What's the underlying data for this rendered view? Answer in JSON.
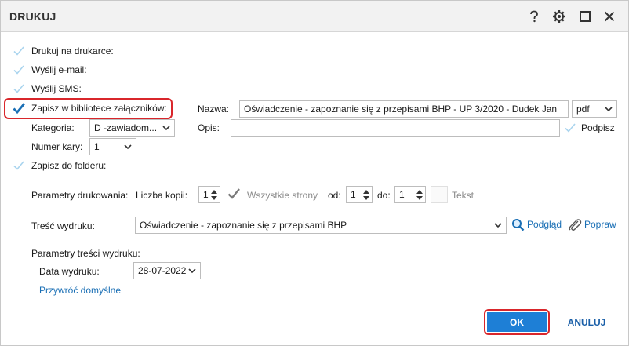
{
  "dialog": {
    "title": "DRUKUJ",
    "help_icon": "question-icon",
    "settings_icon": "gear-icon",
    "maximize_icon": "maximize-icon",
    "close_icon": "close-icon"
  },
  "options": {
    "print_printer": "Drukuj na drukarce:",
    "send_email": "Wyślij e-mail:",
    "send_sms": "Wyślij SMS:",
    "save_library": "Zapisz w bibliotece załączników:",
    "save_folder": "Zapisz do folderu:"
  },
  "library": {
    "name_label": "Nazwa:",
    "name_value": "Oświadczenie - zapoznanie się z przepisami BHP - UP 3/2020 - Dudek Jan",
    "format_value": "pdf",
    "category_label": "Kategoria:",
    "category_value": "D   -zawiadom...",
    "description_label": "Opis:",
    "description_value": "",
    "signature_label": "Podpisz",
    "card_number_label": "Numer kary:",
    "card_number_value": "1"
  },
  "print_params": {
    "label": "Parametry drukowania:",
    "copies_label": "Liczba kopii:",
    "copies_value": "1",
    "all_pages_label": "Wszystkie strony",
    "from_label": "od:",
    "from_value": "1",
    "to_label": "do:",
    "to_value": "1",
    "text_label": "Tekst"
  },
  "content": {
    "label": "Treść wydruku:",
    "value": "Oświadczenie - zapoznanie się z przepisami BHP",
    "preview_label": "Podgląd",
    "fix_label": "Popraw"
  },
  "content_params": {
    "label": "Parametry treści wydruku:",
    "date_label": "Data wydruku:",
    "date_value": "28-07-2022",
    "restore_label": "Przywróć domyślne"
  },
  "footer": {
    "ok_label": "OK",
    "cancel_label": "ANULUJ"
  },
  "colors": {
    "accent": "#1e7fd6",
    "highlight": "#d9262b",
    "check_active": "#1a6fb5",
    "check_inactive": "#a9d4ee"
  }
}
